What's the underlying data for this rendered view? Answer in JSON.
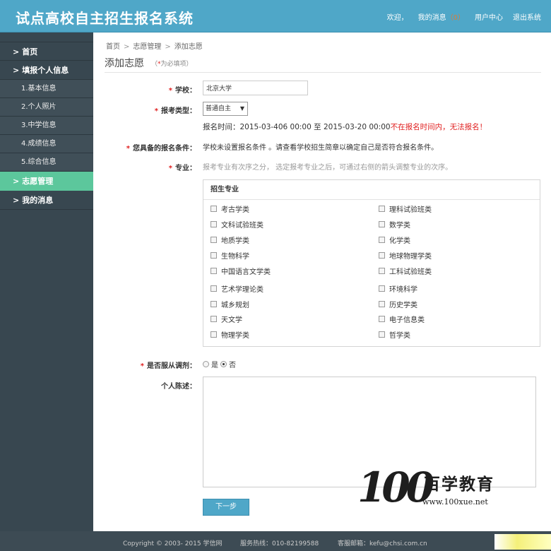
{
  "header": {
    "title": "试点高校自主招生报名系统",
    "welcome": "欢迎，",
    "my_messages": "我的消息",
    "message_count": "（0）",
    "user_center": "用户中心",
    "logout": "退出系统"
  },
  "sidebar": {
    "items": [
      {
        "label": "首页",
        "chev": ">"
      },
      {
        "label": "填报个人信息",
        "chev": ">"
      },
      {
        "label": "1.基本信息"
      },
      {
        "label": "2.个人照片"
      },
      {
        "label": "3.中学信息"
      },
      {
        "label": "4.成绩信息"
      },
      {
        "label": "5.综合信息"
      },
      {
        "label": "志愿管理",
        "chev": ">"
      },
      {
        "label": "我的消息",
        "chev": ">"
      }
    ]
  },
  "breadcrumb": [
    "首页",
    "志愿管理",
    "添加志愿"
  ],
  "breadcrumb_sep": ">",
  "page_title": "添加志愿",
  "required_note": {
    "open": "（",
    "star": "*",
    "text": "为必填项）"
  },
  "form": {
    "star": "*",
    "school_label": "学校：",
    "school_value": "北京大学",
    "type_label": "报考类型：",
    "type_value": "普通自主",
    "time_text": "报名时间：2015-03-406 00:00 至 2015-03-20 00:00",
    "time_warning": "不在报名时间内，无法报名！",
    "condition_label": "您具备的报名条件：",
    "condition_text": "学校未设置报名条件 。请查看学校招生简章以确定自己是否符合报名条件。",
    "major_label": "专业：",
    "major_hint": "报考专业有次序之分， 选定报考专业之后，可通过右侧的箭头调整专业的次序。",
    "major_box_title": "招生专业",
    "majors_left": [
      "考古学类",
      "文科试验班类",
      "地质学类",
      "生物科学",
      "中国语言文学类",
      "艺术学理论类",
      "城乡规划",
      "天文学",
      "物理学类"
    ],
    "majors_right": [
      "理科试验班类",
      "数学类",
      "化学类",
      "地球物理学类",
      "工科试验班类",
      "环境科学",
      "历史学类",
      "电子信息类",
      "哲学类"
    ],
    "adjust_label": "是否服从调剂：",
    "adjust_yes": "是",
    "adjust_no": "否",
    "statement_label": "个人陈述：",
    "next_button": "下一步"
  },
  "watermark": {
    "num": "100",
    "cn": "百学教育",
    "url": "www.100xue.net"
  },
  "footer": {
    "copyright": "Copyright © 2003- 2015 学信网",
    "hotline": "服务热线：010-82199588",
    "email": "客服邮箱：kefu@chsi.com.cn"
  },
  "colors": {
    "header_bg": "#4fa7c8",
    "sidebar_bg": "#384750",
    "active_bg": "#5cc79c",
    "warning": "#e02020"
  }
}
